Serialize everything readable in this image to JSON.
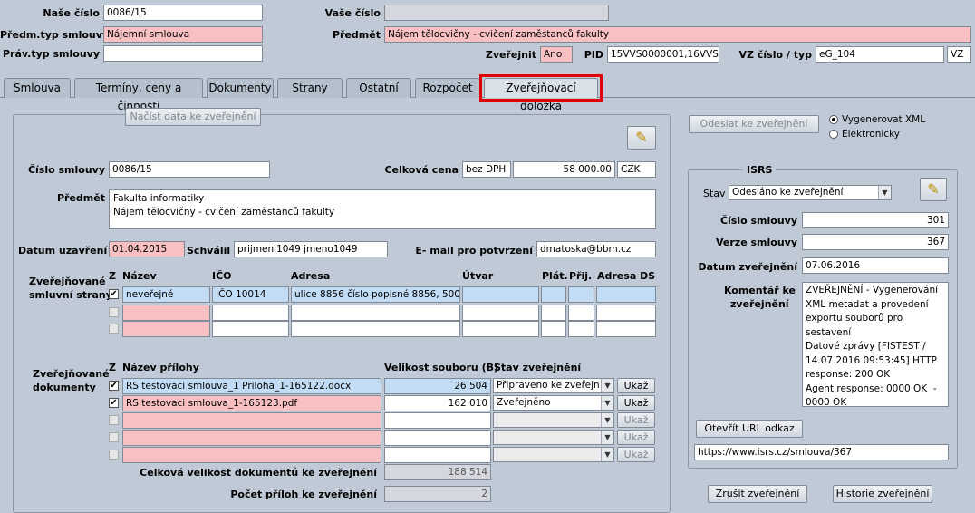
{
  "header": {
    "nase_cislo_label": "Naše číslo",
    "nase_cislo": "0086/15",
    "vase_cislo_label": "Vaše číslo",
    "vase_cislo": "",
    "predm_typ_label": "Předm.typ smlouvy",
    "predm_typ": "Nájemní smlouva",
    "predmet_label": "Předmět",
    "predmet": "Nájem tělocvičny - cvičení zaměstanců fakulty",
    "prav_typ_label": "Práv.typ smlouvy",
    "prav_typ": "",
    "zverejnit_label": "Zveřejnit",
    "zverejnit": "Ano",
    "pid_label": "PID",
    "pid": "15VVS0000001,16VVS0",
    "vz_label": "VZ číslo / typ",
    "vz_cislo": "eG_104",
    "vz_typ": "VZ"
  },
  "tabs": [
    "Smlouva",
    "Termíny, ceny a činnosti",
    "Dokumenty",
    "Strany",
    "Ostatní",
    "Rozpočet",
    "Zveřejňovací doložka"
  ],
  "left": {
    "nacist_btn": "Načíst data ke zveřejnění",
    "cislo_label": "Číslo smlouvy",
    "cislo": "0086/15",
    "cena_label": "Celková cena",
    "cena_typ": "bez DPH",
    "cena": "58 000.00",
    "mena": "CZK",
    "predmet_label": "Předmět",
    "predmet_lines": "Fakulta informatiky\nNájem tělocvičny - cvičení zaměstanců fakulty",
    "datum_label": "Datum uzavření",
    "datum": "01.04.2015",
    "schvalil_label": "Schválil",
    "schvalil": "prijmeni1049 jmeno1049",
    "email_label": "E- mail pro potvrzení",
    "email": "dmatoska@bbm.cz",
    "strany_label_1": "Zveřejňované",
    "strany_label_2": "smluvní strany",
    "strany_cols": [
      "Z",
      "Název",
      "IČO",
      "Adresa",
      "Útvar",
      "Plát.",
      "Přij.",
      "Adresa DS"
    ],
    "strany_row1": {
      "nazev": "neveřejné",
      "ico": "IČO 10014",
      "adresa": "ulice 8856 číslo popisné 8856, 500 06"
    },
    "dok_label_1": "Zveřejňované",
    "dok_label_2": "dokumenty",
    "dok_cols": [
      "Z",
      "Název přílohy",
      "Velikost souboru (B)",
      "Stav zveřejnění"
    ],
    "dok_rows": [
      {
        "nazev": "RS testovaci smlouva_1 Priloha_1-165122.docx",
        "velikost": "26 504",
        "stav": "Připraveno ke zveřejn..."
      },
      {
        "nazev": "RS testovaci smlouva_1-165123.pdf",
        "velikost": "162 010",
        "stav": "Zveřejněno"
      }
    ],
    "ukaz": "Ukaž",
    "celk_vel_label": "Celková velikost dokumentů ke zveřejnění",
    "celk_vel": "188 514",
    "pocet_label": "Počet příloh ke zveřejnění",
    "pocet": "2"
  },
  "right": {
    "odeslat_btn": "Odeslat ke zveřejnění",
    "radio1": "Vygenerovat XML",
    "radio2": "Elektronicky",
    "isrs_title": "ISRS",
    "stav_label": "Stav",
    "stav": "Odesláno ke zveřejnění",
    "cislo_label": "Číslo smlouvy",
    "cislo": "301",
    "verze_label": "Verze smlouvy",
    "verze": "367",
    "datum_label": "Datum zveřejnění",
    "datum": "07.06.2016",
    "komentar_label_1": "Komentář ke",
    "komentar_label_2": "zveřejnění",
    "komentar": "ZVEŘEJNĚNÍ - Vygenerování\nXML metadat a provedení\nexportu souborů pro sestavení\nDatové zprávy [FISTEST /\n14.07.2016 09:53:45] HTTP\nresponse: 200 OK\nAgent response: 0000 OK  -\n0000 OK",
    "otevrit_btn": "Otevřít URL odkaz",
    "url": "https://www.isrs.cz/smlouva/367",
    "zrusit_btn": "Zrušit zveřejnění",
    "historie_btn": "Historie zveřejnění"
  },
  "colors": {
    "highlight": "#e00000",
    "pink": "#f8c0c0",
    "blue": "#c2dcf6",
    "bg": "#c0cad6"
  }
}
